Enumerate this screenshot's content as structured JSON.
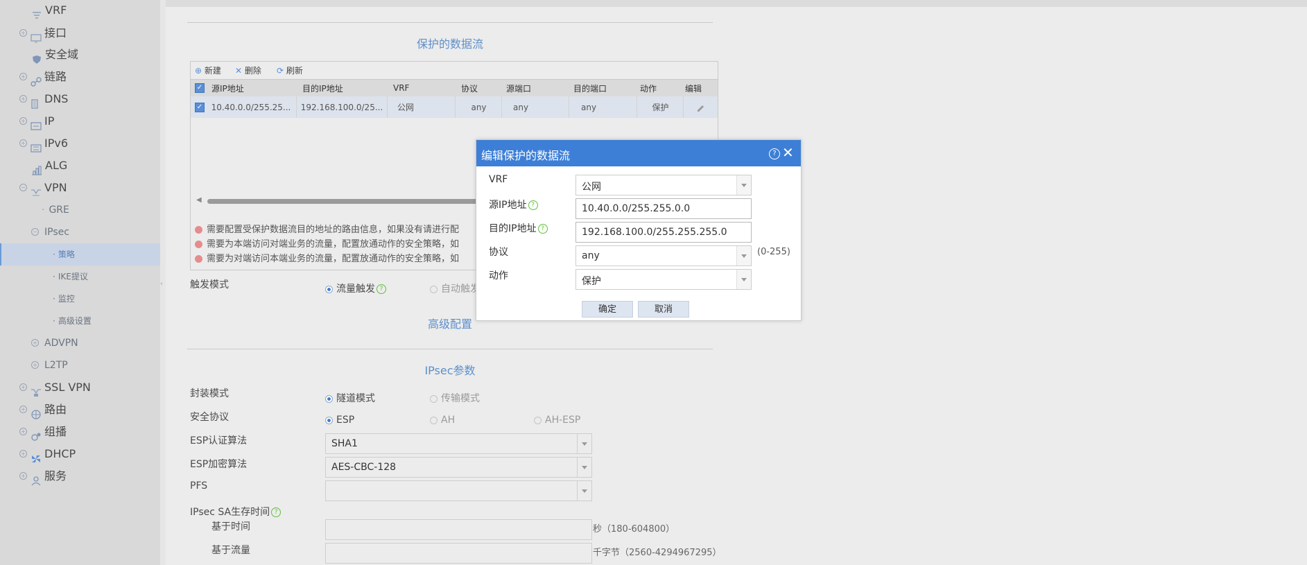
{
  "sidebar": {
    "items": [
      {
        "label": "VRF",
        "level": "sub",
        "icon": "vrf-icon"
      },
      {
        "label": "接口",
        "level": "top",
        "icon": "interface-icon"
      },
      {
        "label": "安全域",
        "level": "top",
        "icon": "shield-icon"
      },
      {
        "label": "链路",
        "level": "top",
        "icon": "link-icon"
      },
      {
        "label": "DNS",
        "level": "top",
        "icon": "dns-icon"
      },
      {
        "label": "IP",
        "level": "top",
        "icon": "ip-icon"
      },
      {
        "label": "IPv6",
        "level": "top",
        "icon": "ipv6-icon"
      },
      {
        "label": "ALG",
        "level": "top",
        "icon": "alg-icon"
      },
      {
        "label": "VPN",
        "level": "top",
        "icon": "vpn-icon"
      },
      {
        "label": "GRE",
        "level": "sub"
      },
      {
        "label": "IPsec",
        "level": "sub"
      },
      {
        "label": "策略",
        "level": "sub2",
        "active": true
      },
      {
        "label": "IKE提议",
        "level": "sub2"
      },
      {
        "label": "监控",
        "level": "sub2"
      },
      {
        "label": "高级设置",
        "level": "sub2"
      },
      {
        "label": "ADVPN",
        "level": "sub"
      },
      {
        "label": "L2TP",
        "level": "sub"
      },
      {
        "label": "SSL VPN",
        "level": "top",
        "icon": "sslvpn-icon"
      },
      {
        "label": "路由",
        "level": "top",
        "icon": "route-icon"
      },
      {
        "label": "组播",
        "level": "top",
        "icon": "multicast-icon"
      },
      {
        "label": "DHCP",
        "level": "top",
        "icon": "dhcp-icon"
      },
      {
        "label": "服务",
        "level": "top",
        "icon": "service-icon"
      }
    ]
  },
  "main": {
    "protected_flow_title": "保护的数据流",
    "toolbar": {
      "new_label": "新建",
      "delete_label": "删除",
      "refresh_label": "刷新"
    },
    "columns": [
      "源IP地址",
      "目的IP地址",
      "VRF",
      "协议",
      "源端口",
      "目的端口",
      "动作",
      "编辑"
    ],
    "rows": [
      {
        "src_ip": "10.40.0.0/255.25...",
        "dst_ip": "192.168.100.0/25...",
        "vrf": "公网",
        "protocol": "any",
        "src_port": "any",
        "dst_port": "any",
        "action": "保护"
      }
    ],
    "notes": [
      "需要配置受保护数据流目的地址的路由信息，如果没有请进行配",
      "需要为本端访问对端业务的流量，配置放通动作的安全策略，如",
      "需要为对端访问本端业务的流量，配置放通动作的安全策略，如"
    ],
    "trigger_mode": {
      "label": "触发模式",
      "option_traffic": "流量触发",
      "option_auto": "自动触发"
    },
    "advanced_title": "高级配置",
    "ipsec_params_title": "IPsec参数",
    "encap_mode": {
      "label": "封装模式",
      "option_tunnel": "隧道模式",
      "option_transport": "传输模式"
    },
    "security_protocol": {
      "label": "安全协议",
      "option_esp": "ESP",
      "option_ah": "AH",
      "option_ah_esp": "AH-ESP"
    },
    "esp_auth": {
      "label": "ESP认证算法",
      "value": "SHA1"
    },
    "esp_encrypt": {
      "label": "ESP加密算法",
      "value": "AES-CBC-128"
    },
    "pfs": {
      "label": "PFS",
      "value": ""
    },
    "sa_lifetime": {
      "label": "IPsec SA生存时间",
      "time_label": "基于时间",
      "time_unit": "秒（180-604800）",
      "traffic_label": "基于流量",
      "traffic_unit": "千字节（2560-4294967295）"
    }
  },
  "dialog": {
    "title": "编辑保护的数据流",
    "vrf": {
      "label": "VRF",
      "value": "公网"
    },
    "src_ip": {
      "label": "源IP地址",
      "value": "10.40.0.0/255.255.0.0"
    },
    "dst_ip": {
      "label": "目的IP地址",
      "value": "192.168.100.0/255.255.255.0"
    },
    "protocol": {
      "label": "协议",
      "value": "any",
      "range": "(0-255)"
    },
    "action": {
      "label": "动作",
      "value": "保护"
    },
    "ok_label": "确定",
    "cancel_label": "取消"
  },
  "colors": {
    "accent": "#3d7fd6",
    "title_blue": "#5e8fc9",
    "help_green": "#5fbf3c",
    "note_dot": "#e58c8c"
  }
}
